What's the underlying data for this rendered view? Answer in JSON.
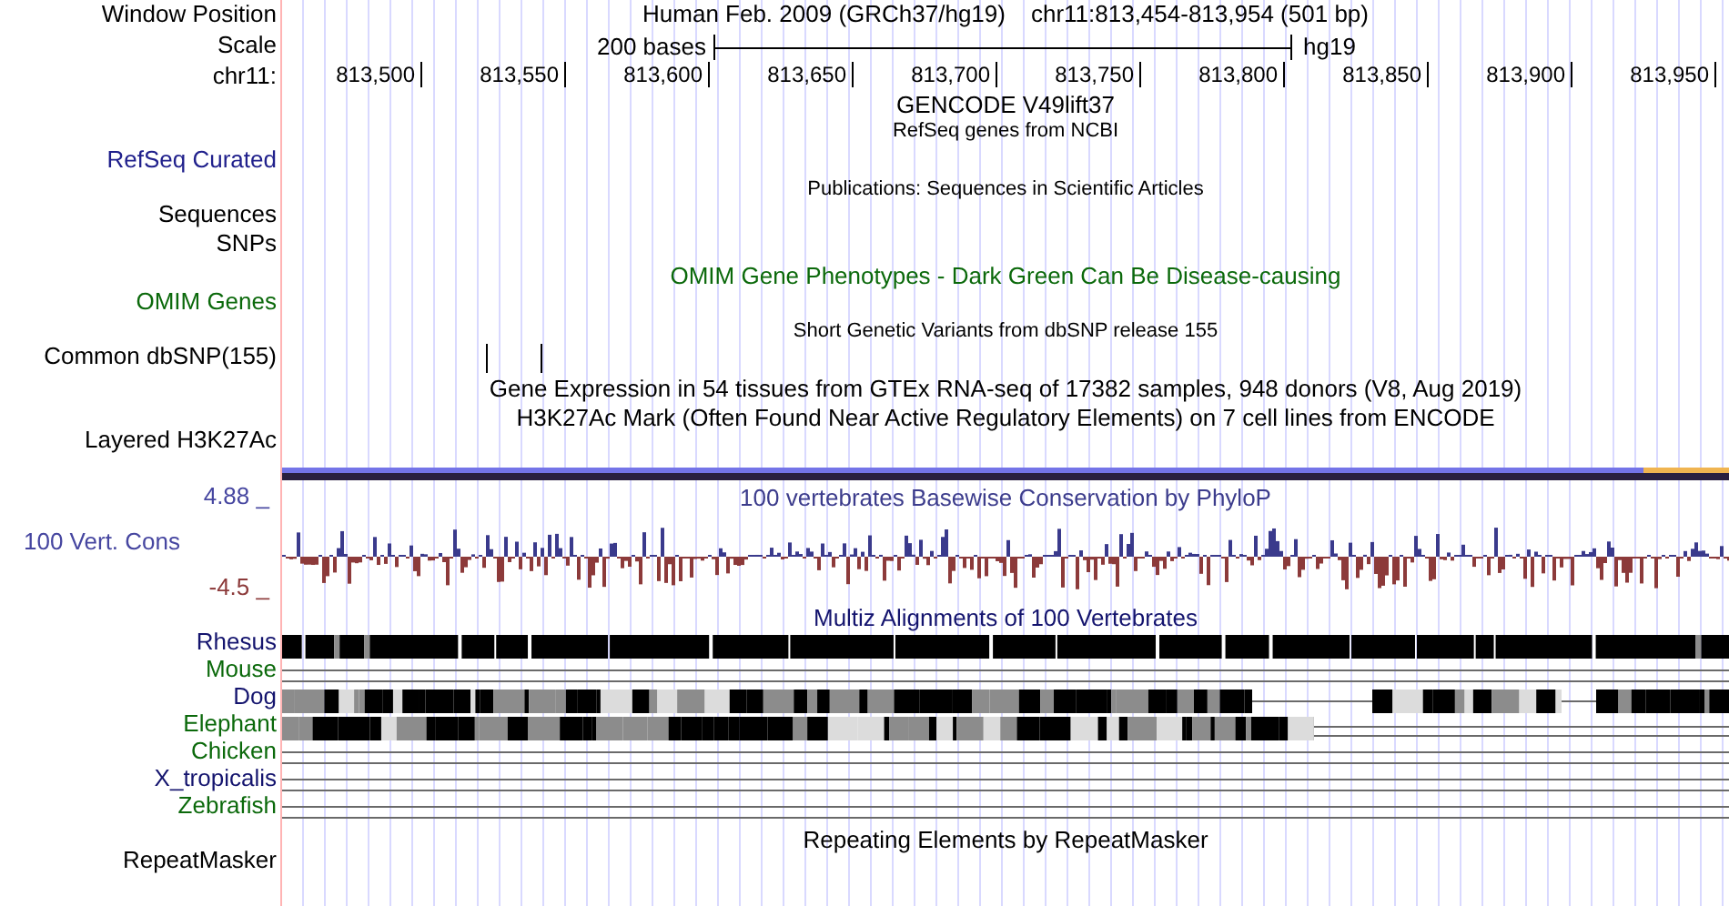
{
  "header": {
    "label": "Window Position",
    "title": "Human Feb. 2009 (GRCh37/hg19)",
    "position": "chr11:813,454-813,954 (501 bp)"
  },
  "scale": {
    "label": "Scale",
    "length": "200 bases",
    "assembly": "hg19"
  },
  "ruler": {
    "label": "chr11:",
    "ticks": [
      "813,500",
      "813,550",
      "813,600",
      "813,650",
      "813,700",
      "813,750",
      "813,800",
      "813,850",
      "813,900",
      "813,950"
    ]
  },
  "side_labels": [
    {
      "text": "RefSeq Curated",
      "color": "#20208c"
    },
    {
      "text": "Sequences",
      "color": "#000000"
    },
    {
      "text": "SNPs",
      "color": "#000000"
    },
    {
      "text": "OMIM Genes",
      "color": "#0b690b"
    },
    {
      "text": "Common dbSNP(155)",
      "color": "#000000"
    },
    {
      "text": "Layered H3K27Ac",
      "color": "#000000"
    }
  ],
  "track_titles": [
    {
      "text": "GENCODE V49lift37",
      "kind": "large",
      "color": "#000000"
    },
    {
      "text": "RefSeq genes from NCBI",
      "kind": "small",
      "color": "#000000"
    },
    {
      "text": "Publications: Sequences in Scientific Articles",
      "kind": "small",
      "color": "#000000"
    },
    {
      "text": "OMIM Gene Phenotypes - Dark Green Can Be Disease-causing",
      "kind": "large",
      "color": "#0b690b"
    },
    {
      "text": "Short Genetic Variants from dbSNP release 155",
      "kind": "small",
      "color": "#000000"
    },
    {
      "text": "Gene Expression in 54 tissues from GTEx RNA-seq of 17382 samples, 948 donors (V8, Aug 2019)",
      "kind": "large",
      "color": "#000000"
    },
    {
      "text": "H3K27Ac Mark (Often Found Near Active Regulatory Elements) on 7 cell lines from ENCODE",
      "kind": "large",
      "color": "#000000"
    },
    {
      "text": "100 vertebrates Basewise Conservation by PhyloP",
      "kind": "large",
      "color": "#3c3c8c"
    },
    {
      "text": "Multiz Alignments of 100 Vertebrates",
      "kind": "large",
      "color": "#14146e"
    },
    {
      "text": "Repeating Elements by RepeatMasker",
      "kind": "large",
      "color": "#000000"
    }
  ],
  "conservation": {
    "max_label": "4.88 _",
    "label": "100 Vert. Cons",
    "min_label": "-4.5 _"
  },
  "alignment": {
    "species": [
      {
        "name": "Rhesus",
        "color": "#14146e",
        "kind": "solid"
      },
      {
        "name": "Mouse",
        "color": "#0b690b",
        "kind": "none"
      },
      {
        "name": "Dog",
        "color": "#14146e",
        "kind": "mixed"
      },
      {
        "name": "Elephant",
        "color": "#0b690b",
        "kind": "mixed"
      },
      {
        "name": "Chicken",
        "color": "#0b690b",
        "kind": "none"
      },
      {
        "name": "X_tropicalis",
        "color": "#14146e",
        "kind": "none"
      },
      {
        "name": "Zebrafish",
        "color": "#0b690b",
        "kind": "none"
      }
    ]
  },
  "repeat_label": "RepeatMasker"
}
